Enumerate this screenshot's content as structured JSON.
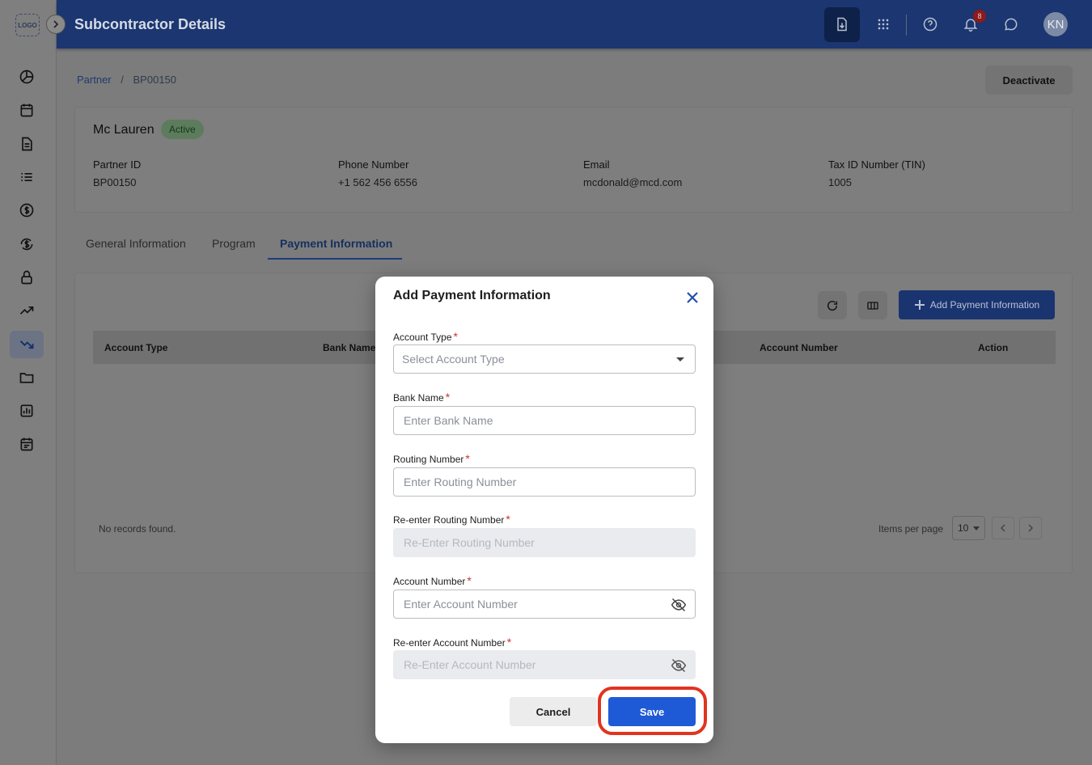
{
  "app": {
    "logo_text": "LOGO",
    "page_title": "Subcontractor Details",
    "notification_count": "8",
    "user_initials": "KN"
  },
  "sidebar": {
    "items": [
      {
        "icon": "dashboard-icon"
      },
      {
        "icon": "calendar-icon"
      },
      {
        "icon": "document-icon"
      },
      {
        "icon": "list-icon"
      },
      {
        "icon": "dollar-icon"
      },
      {
        "icon": "dollar-exchange-icon"
      },
      {
        "icon": "lock-icon"
      },
      {
        "icon": "trending-up-icon"
      },
      {
        "icon": "trending-down-icon",
        "active": true
      },
      {
        "icon": "folder-icon"
      },
      {
        "icon": "report-icon"
      },
      {
        "icon": "schedule-icon"
      }
    ]
  },
  "breadcrumb": {
    "parent": "Partner",
    "separator": "/",
    "current": "BP00150"
  },
  "header_actions": {
    "deactivate_label": "Deactivate"
  },
  "partner": {
    "name": "Mc Lauren",
    "status": "Active",
    "fields": [
      {
        "label": "Partner ID",
        "value": "BP00150"
      },
      {
        "label": "Phone Number",
        "value": "+1 562 456 6556"
      },
      {
        "label": "Email",
        "value": "mcdonald@mcd.com"
      },
      {
        "label": "Tax ID Number (TIN)",
        "value": "1005"
      }
    ]
  },
  "tabs": [
    {
      "label": "General Information"
    },
    {
      "label": "Program"
    },
    {
      "label": "Payment Information",
      "active": true
    }
  ],
  "table": {
    "add_label": "Add Payment Information",
    "columns": [
      "Account Type",
      "Bank Name",
      "Account Number",
      "Action"
    ],
    "empty_text": "No records found.",
    "items_per_page_label": "Items per page",
    "items_per_page_value": "10"
  },
  "modal": {
    "title": "Add Payment Information",
    "fields": {
      "account_type": {
        "label": "Account Type",
        "placeholder": "Select Account Type"
      },
      "bank_name": {
        "label": "Bank Name",
        "placeholder": "Enter Bank Name"
      },
      "routing_number": {
        "label": "Routing Number",
        "placeholder": "Enter Routing Number"
      },
      "reenter_routing": {
        "label": "Re-enter Routing Number",
        "placeholder": "Re-Enter Routing Number"
      },
      "account_number": {
        "label": "Account Number",
        "placeholder": "Enter Account Number"
      },
      "reenter_account": {
        "label": "Re-enter Account Number",
        "placeholder": "Re-Enter Account Number"
      }
    },
    "required_mark": "*",
    "cancel_label": "Cancel",
    "save_label": "Save"
  },
  "colors": {
    "primary": "#1f5ad6",
    "header": "#1b3670",
    "required": "#d0312d",
    "highlight": "#e0341f"
  }
}
